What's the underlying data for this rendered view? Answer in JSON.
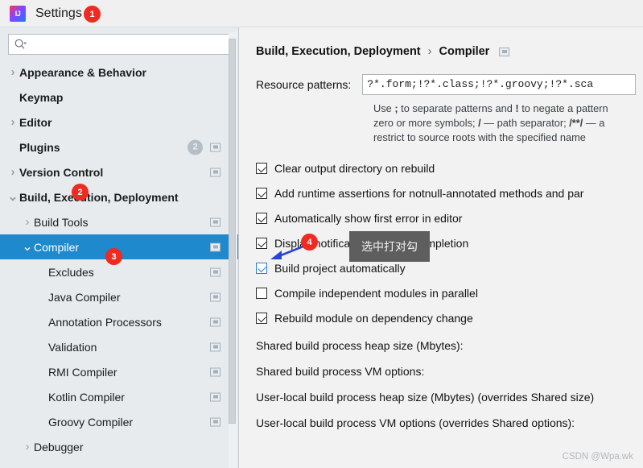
{
  "window": {
    "title": "Settings",
    "logo_text": "IJ",
    "logo_icon": "intellij-idea-logo"
  },
  "annotations": {
    "markers": [
      {
        "id": "1",
        "label": "1"
      },
      {
        "id": "2",
        "label": "2"
      },
      {
        "id": "3",
        "label": "3"
      },
      {
        "id": "4",
        "label": "4"
      }
    ],
    "tooltip_text": "选中打对勾",
    "arrow_color": "#2a44d8",
    "marker_color": "#f02a21",
    "tooltip_bg": "#5e5e5e"
  },
  "sidebar": {
    "search": {
      "value": "",
      "placeholder": "",
      "icon": "search-icon"
    },
    "items": [
      {
        "label": "Appearance & Behavior",
        "arrow": "collapsed",
        "bold": true,
        "indent": 0,
        "mod_icon": false,
        "count": null,
        "selected": false
      },
      {
        "label": "Keymap",
        "arrow": "none",
        "bold": true,
        "indent": 0,
        "mod_icon": false,
        "count": null,
        "selected": false
      },
      {
        "label": "Editor",
        "arrow": "collapsed",
        "bold": true,
        "indent": 0,
        "mod_icon": false,
        "count": null,
        "selected": false
      },
      {
        "label": "Plugins",
        "arrow": "none",
        "bold": true,
        "indent": 0,
        "mod_icon": true,
        "count": "2",
        "selected": false
      },
      {
        "label": "Version Control",
        "arrow": "collapsed",
        "bold": true,
        "indent": 0,
        "mod_icon": true,
        "count": null,
        "selected": false
      },
      {
        "label": "Build, Execution, Deployment",
        "arrow": "expanded",
        "bold": true,
        "indent": 0,
        "mod_icon": false,
        "count": null,
        "selected": false
      },
      {
        "label": "Build Tools",
        "arrow": "collapsed",
        "bold": false,
        "indent": 1,
        "mod_icon": true,
        "count": null,
        "selected": false
      },
      {
        "label": "Compiler",
        "arrow": "expanded",
        "bold": false,
        "indent": 1,
        "mod_icon": true,
        "count": null,
        "selected": true
      },
      {
        "label": "Excludes",
        "arrow": "none",
        "bold": false,
        "indent": 2,
        "mod_icon": true,
        "count": null,
        "selected": false
      },
      {
        "label": "Java Compiler",
        "arrow": "none",
        "bold": false,
        "indent": 2,
        "mod_icon": true,
        "count": null,
        "selected": false
      },
      {
        "label": "Annotation Processors",
        "arrow": "none",
        "bold": false,
        "indent": 2,
        "mod_icon": true,
        "count": null,
        "selected": false
      },
      {
        "label": "Validation",
        "arrow": "none",
        "bold": false,
        "indent": 2,
        "mod_icon": true,
        "count": null,
        "selected": false
      },
      {
        "label": "RMI Compiler",
        "arrow": "none",
        "bold": false,
        "indent": 2,
        "mod_icon": true,
        "count": null,
        "selected": false
      },
      {
        "label": "Kotlin Compiler",
        "arrow": "none",
        "bold": false,
        "indent": 2,
        "mod_icon": true,
        "count": null,
        "selected": false
      },
      {
        "label": "Groovy Compiler",
        "arrow": "none",
        "bold": false,
        "indent": 2,
        "mod_icon": true,
        "count": null,
        "selected": false
      },
      {
        "label": "Debugger",
        "arrow": "collapsed",
        "bold": false,
        "indent": 1,
        "mod_icon": false,
        "count": null,
        "selected": false
      }
    ],
    "selected_color": "#1f89cd"
  },
  "main": {
    "breadcrumb": {
      "root": "Build, Execution, Deployment",
      "separator": "›",
      "leaf": "Compiler"
    },
    "resource_patterns": {
      "label": "Resource patterns:",
      "value": "?*.form;!?*.class;!?*.groovy;!?*.sca"
    },
    "hint_lines": [
      "Use ; to separate patterns and ! to negate a pattern",
      "zero or more symbols; / — path separator; /**/ — a",
      "restrict to source roots with the specified name"
    ],
    "checkboxes": [
      {
        "label": "Clear output directory on rebuild",
        "checked": true,
        "focused": false
      },
      {
        "label": "Add runtime assertions for notnull-annotated methods and par",
        "checked": true,
        "focused": false
      },
      {
        "label": "Automatically show first error in editor",
        "checked": true,
        "focused": false
      },
      {
        "label": "Display notification on build completion",
        "checked": true,
        "focused": false
      },
      {
        "label": "Build project automatically",
        "checked": true,
        "focused": true
      },
      {
        "label": "Compile independent modules in parallel",
        "checked": false,
        "focused": false
      },
      {
        "label": "Rebuild module on dependency change",
        "checked": true,
        "focused": false
      }
    ],
    "labels": [
      "Shared build process heap size (Mbytes):",
      "Shared build process VM options:",
      "User-local build process heap size (Mbytes) (overrides Shared size)",
      "User-local build process VM options (overrides Shared options):"
    ]
  },
  "watermark": "CSDN @Wpa.wk"
}
